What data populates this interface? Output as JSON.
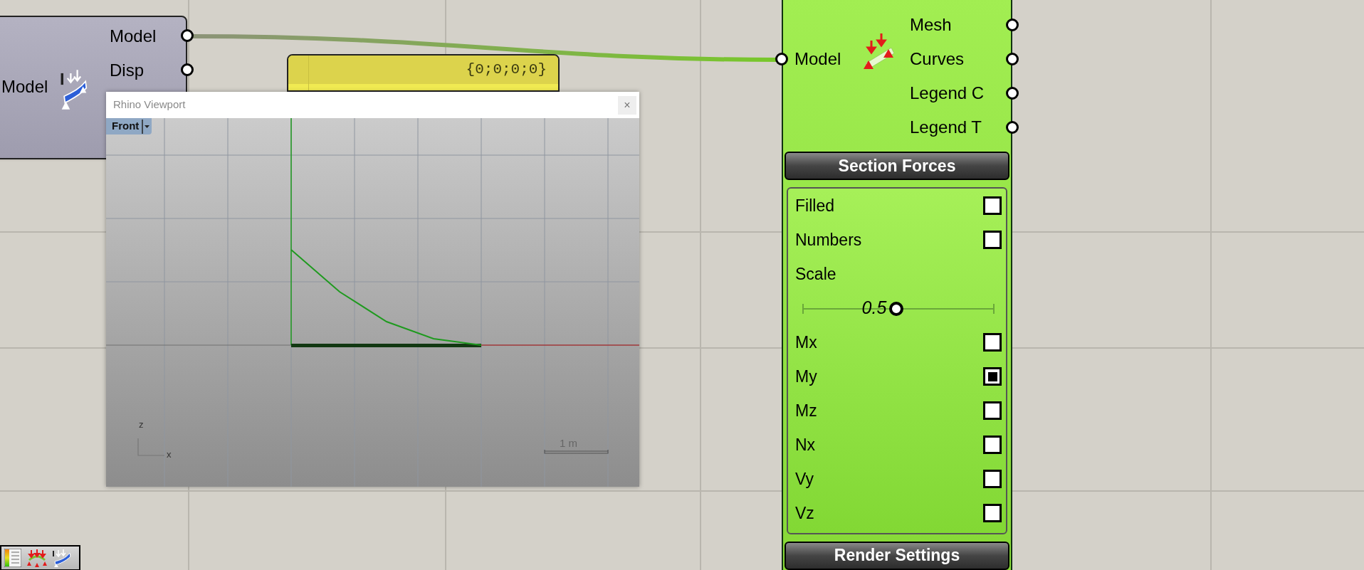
{
  "model_node": {
    "input": "Model",
    "outputs": [
      "Model",
      "Disp"
    ]
  },
  "panel": {
    "value": "{0;0;0;0}"
  },
  "viewport": {
    "title": "Rhino Viewport",
    "close_label": "×",
    "view": "Front",
    "axis_labels": [
      "z",
      "x"
    ],
    "scale_label": "1 m"
  },
  "section_node": {
    "input": "Model",
    "outputs": [
      "Mesh",
      "Curves",
      "Legend C",
      "Legend T"
    ],
    "section_title": "Section Forces",
    "options": [
      {
        "kind": "checkbox",
        "label": "Filled",
        "checked": false
      },
      {
        "kind": "checkbox",
        "label": "Numbers",
        "checked": false
      },
      {
        "kind": "label",
        "label": "Scale"
      },
      {
        "kind": "slider",
        "reading": "0.5",
        "level": 0.49
      },
      {
        "kind": "checkbox",
        "label": "Mx",
        "checked": false
      },
      {
        "kind": "checkbox",
        "label": "My",
        "checked": true
      },
      {
        "kind": "checkbox",
        "label": "Mz",
        "checked": false
      },
      {
        "kind": "checkbox",
        "label": "Nx",
        "checked": false
      },
      {
        "kind": "checkbox",
        "label": "Vy",
        "checked": false
      },
      {
        "kind": "checkbox",
        "label": "Vz",
        "checked": false
      }
    ],
    "footer_button": "Render Settings"
  }
}
